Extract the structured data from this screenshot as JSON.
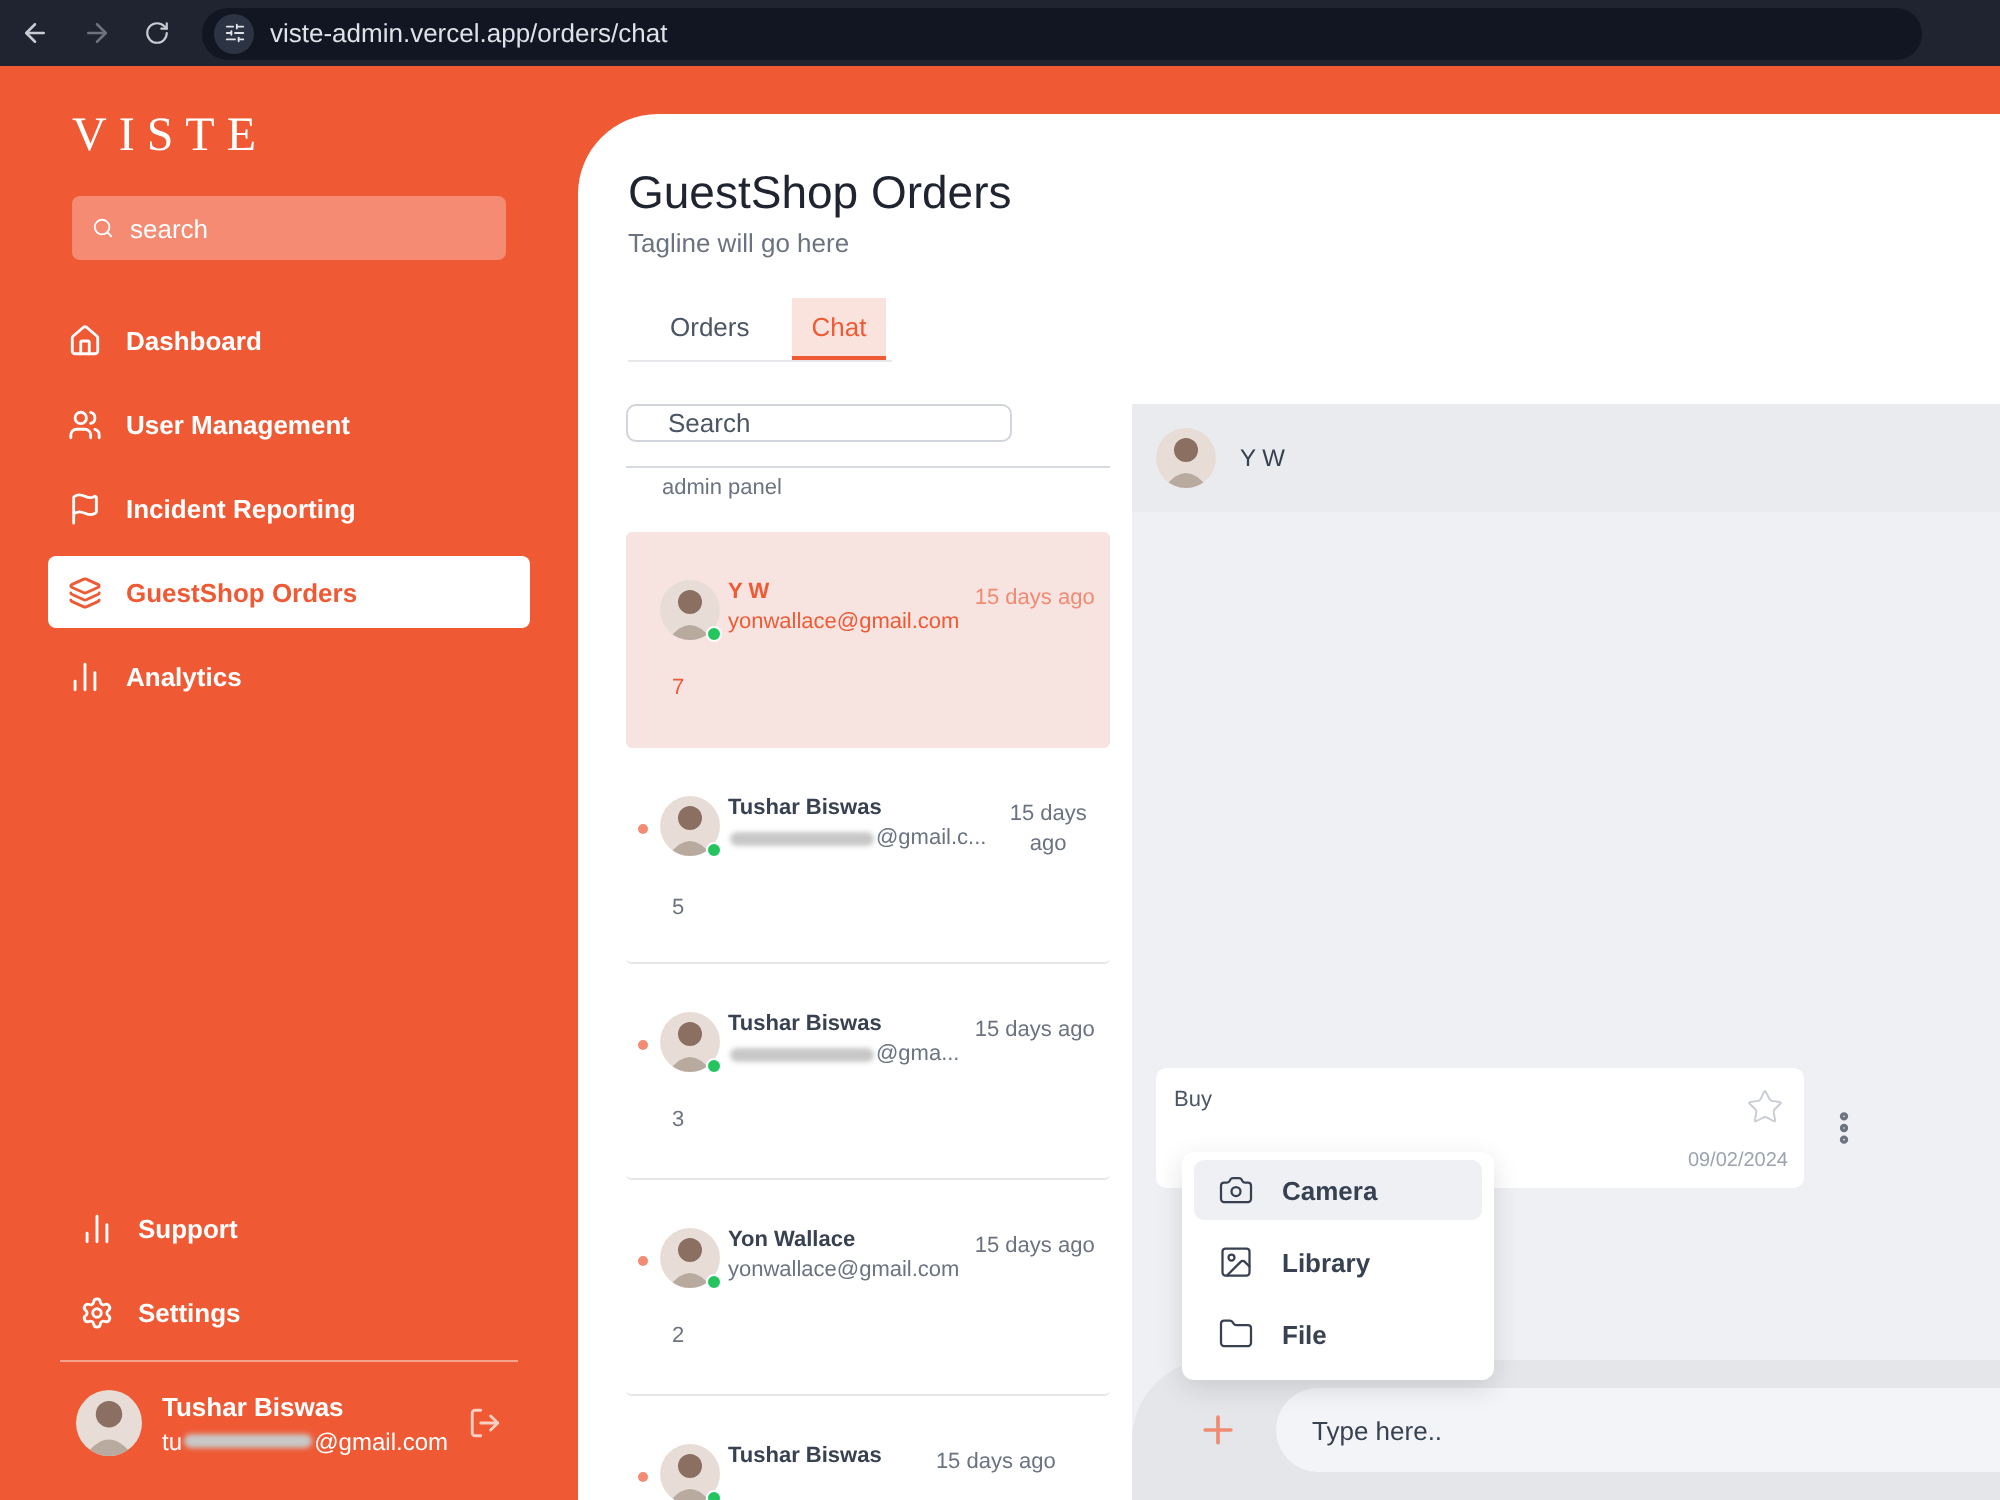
{
  "browser": {
    "url": "viste-admin.vercel.app/orders/chat"
  },
  "sidebar": {
    "logo": "VISTE",
    "search": {
      "placeholder": "search"
    },
    "items": [
      {
        "label": "Dashboard",
        "selected": false
      },
      {
        "label": "User Management",
        "selected": false
      },
      {
        "label": "Incident Reporting",
        "selected": false
      },
      {
        "label": "GuestShop Orders",
        "selected": true
      },
      {
        "label": "Analytics",
        "selected": false
      }
    ],
    "bottom_items": [
      {
        "label": "Support"
      },
      {
        "label": "Settings"
      }
    ],
    "user": {
      "name": "Tushar Biswas",
      "email_start": "tu",
      "email_end": "@gmail.com",
      "redacted": true
    }
  },
  "page": {
    "title": "GuestShop Orders",
    "tagline": "Tagline will go here"
  },
  "tabs": [
    {
      "label": "Orders",
      "selected": false
    },
    {
      "label": "Chat",
      "selected": true
    }
  ],
  "chat_list": {
    "search": {
      "placeholder": "Search"
    },
    "top_snippet": "admin panel",
    "rows": [
      {
        "name": "Y W",
        "email": "yonwallace@gmail.com",
        "time": "15 days ago",
        "count": "7",
        "selected": true,
        "unread": false,
        "online": true,
        "redacted": false
      },
      {
        "name": "Tushar Biswas",
        "email": "@gmail.c...",
        "time": "15 days ago",
        "count": "5",
        "selected": false,
        "unread": true,
        "online": true,
        "redacted": true
      },
      {
        "name": "Tushar Biswas",
        "email": "@gma...",
        "time": "15 days ago",
        "count": "3",
        "selected": false,
        "unread": true,
        "online": true,
        "redacted": true
      },
      {
        "name": "Yon Wallace",
        "email": "yonwallace@gmail.com",
        "time": "15 days ago",
        "count": "2",
        "selected": false,
        "unread": true,
        "online": true,
        "redacted": false
      },
      {
        "name": "Tushar Biswas",
        "time": "15 days ago",
        "selected": false,
        "unread": true,
        "online": true
      }
    ]
  },
  "conversation": {
    "contact": "Y W",
    "messages": [
      {
        "text": "Buy",
        "date": "09/02/2024",
        "starred": false
      }
    ],
    "attach_menu": [
      {
        "label": "Camera",
        "selected": true
      },
      {
        "label": "Library",
        "selected": false
      },
      {
        "label": "File",
        "selected": false
      }
    ],
    "composer": {
      "placeholder": "Type here.."
    }
  }
}
